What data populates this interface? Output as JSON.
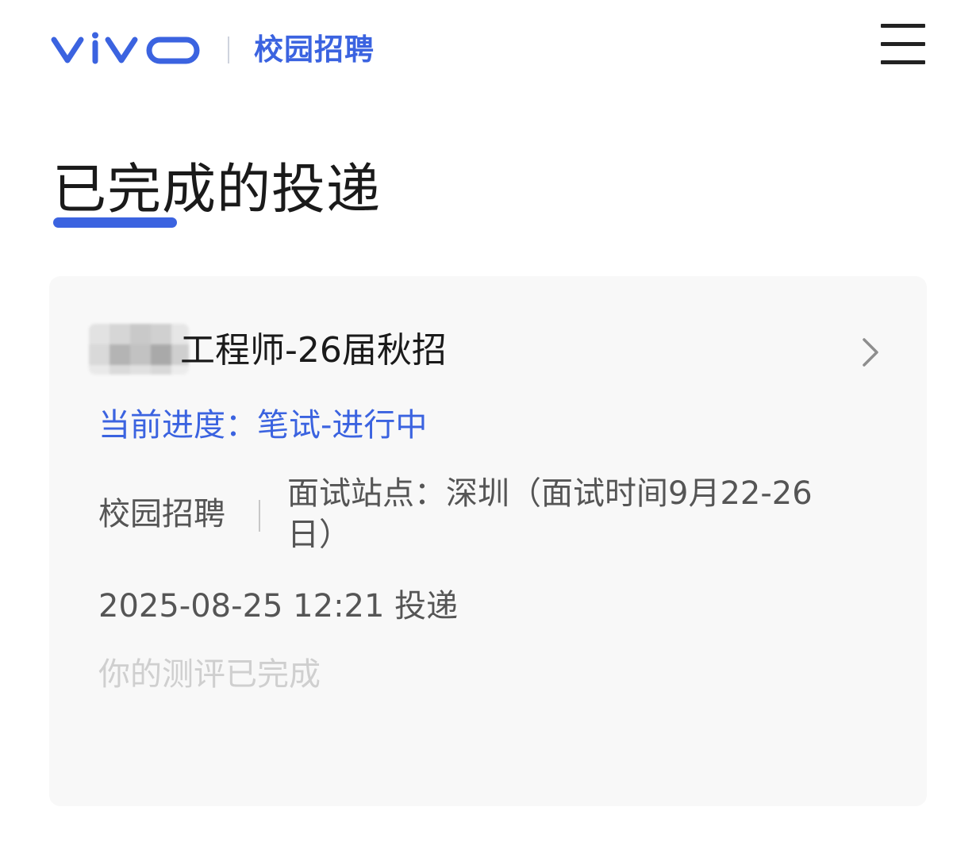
{
  "header": {
    "logo_text": "vivo",
    "subtitle": "校园招聘",
    "menu_icon": "hamburger-menu-icon",
    "brand_color": "#3b63e0"
  },
  "page": {
    "title": "已完成的投递"
  },
  "application": {
    "job_title_suffix": "工程师-26届秋招",
    "progress_label": "当前进度：",
    "progress_value": "笔试-进行中",
    "channel": "校园招聘",
    "site": "面试站点：深圳（面试时间9月22-26日）",
    "submit_time": "2025-08-25 12:21 投递",
    "evaluation_status": "你的测评已完成",
    "chevron_icon": "chevron-right-icon"
  }
}
